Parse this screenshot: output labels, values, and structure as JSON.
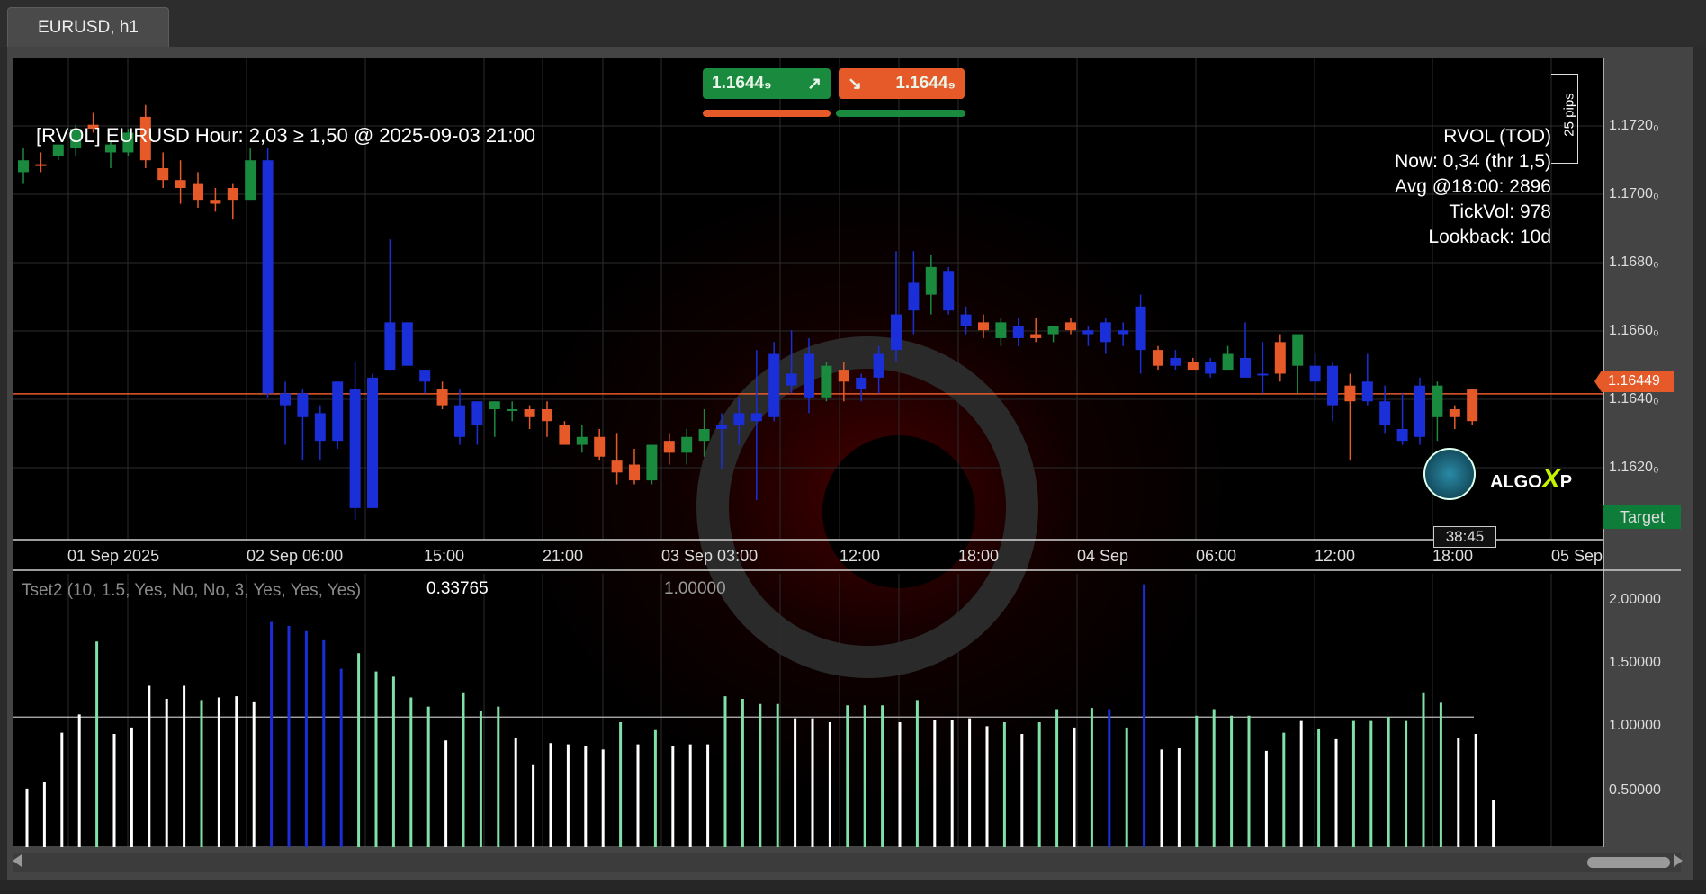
{
  "tab": {
    "label": "EURUSD, h1"
  },
  "quote": {
    "buy_price": "1.1644₉",
    "sell_price": "1.1644₉"
  },
  "rvol_header": "[RVOL] EURUSD Hour: 2,03 ≥ 1,50 @ 2025-09-03 21:00",
  "rvol_box": {
    "title": "RVOL (TOD)",
    "now": "Now: 0,34 (thr 1,5)",
    "avg": "Avg @18:00: 2896",
    "tickvol": "TickVol: 978",
    "lookback": "Lookback: 10d"
  },
  "pips_label": "25 pips",
  "price_axis": [
    "1.1720₀",
    "1.1700₀",
    "1.1680₀",
    "1.1660₀",
    "1.1640₀",
    "1.1620₀"
  ],
  "current_price": "1.16449",
  "time_axis": [
    "01 Sep 2025",
    "02 Sep 06:00",
    "15:00",
    "21:00",
    "03 Sep 03:00",
    "12:00",
    "18:00",
    "04 Sep",
    "06:00",
    "12:00",
    "18:00",
    "05 Sep"
  ],
  "target_label": "Target",
  "timer": "38:45",
  "brand": {
    "text": "ALGO",
    "x": "X",
    "p": "P"
  },
  "indicator": {
    "label": "Tset2 (10, 1.5, Yes, No, No, 3, Yes, Yes, Yes)",
    "value": "0.33765",
    "level": "1.00000",
    "axis": [
      "2.00000",
      "1.50000",
      "1.00000",
      "0.50000"
    ]
  },
  "colors": {
    "bull": "#1a8a3f",
    "bear": "#e65a2a",
    "highvol": "#1a2fd8",
    "mint": "#7fe0a8",
    "white": "#ffffff"
  },
  "chart_data": {
    "type": "candlestick",
    "candles": [
      {
        "o": 1.1704,
        "h": 1.1707,
        "l": 1.1698,
        "c": 1.1701
      },
      {
        "o": 1.1703,
        "h": 1.1706,
        "l": 1.1701,
        "c": 1.1703
      },
      {
        "o": 1.1705,
        "h": 1.1708,
        "l": 1.1704,
        "c": 1.1708
      },
      {
        "o": 1.1707,
        "h": 1.1713,
        "l": 1.1705,
        "c": 1.1712
      },
      {
        "o": 1.1713,
        "h": 1.1716,
        "l": 1.1711,
        "c": 1.1712
      },
      {
        "o": 1.1706,
        "h": 1.1709,
        "l": 1.1702,
        "c": 1.1708
      },
      {
        "o": 1.1706,
        "h": 1.1712,
        "l": 1.1705,
        "c": 1.1711
      },
      {
        "o": 1.1715,
        "h": 1.1718,
        "l": 1.1702,
        "c": 1.1704
      },
      {
        "o": 1.1702,
        "h": 1.1706,
        "l": 1.1697,
        "c": 1.1699
      },
      {
        "o": 1.1699,
        "h": 1.1704,
        "l": 1.1693,
        "c": 1.1697
      },
      {
        "o": 1.1698,
        "h": 1.1701,
        "l": 1.1692,
        "c": 1.1694
      },
      {
        "o": 1.1694,
        "h": 1.1697,
        "l": 1.1691,
        "c": 1.1693
      },
      {
        "o": 1.1697,
        "h": 1.1698,
        "l": 1.1689,
        "c": 1.1694
      },
      {
        "o": 1.1694,
        "h": 1.1707,
        "l": 1.1694,
        "c": 1.1704
      },
      {
        "o": 1.1704,
        "h": 1.1707,
        "l": 1.1644,
        "c": 1.1645
      },
      {
        "o": 1.1645,
        "h": 1.1648,
        "l": 1.1632,
        "c": 1.1642
      },
      {
        "o": 1.1645,
        "h": 1.1646,
        "l": 1.1628,
        "c": 1.1639
      },
      {
        "o": 1.164,
        "h": 1.1642,
        "l": 1.1628,
        "c": 1.1633
      },
      {
        "o": 1.1633,
        "h": 1.1648,
        "l": 1.1631,
        "c": 1.1648
      },
      {
        "o": 1.1646,
        "h": 1.1653,
        "l": 1.1613,
        "c": 1.1616
      },
      {
        "o": 1.1616,
        "h": 1.165,
        "l": 1.1616,
        "c": 1.1649
      },
      {
        "o": 1.1651,
        "h": 1.1684,
        "l": 1.1651,
        "c": 1.1663
      },
      {
        "o": 1.1663,
        "h": 1.1663,
        "l": 1.1652,
        "c": 1.1652
      },
      {
        "o": 1.1651,
        "h": 1.1651,
        "l": 1.1645,
        "c": 1.1648
      },
      {
        "o": 1.1646,
        "h": 1.1648,
        "l": 1.1641,
        "c": 1.1642
      },
      {
        "o": 1.1642,
        "h": 1.1646,
        "l": 1.1632,
        "c": 1.1634
      },
      {
        "o": 1.1637,
        "h": 1.1643,
        "l": 1.1632,
        "c": 1.1643
      },
      {
        "o": 1.1643,
        "h": 1.1643,
        "l": 1.1634,
        "c": 1.1641
      },
      {
        "o": 1.1641,
        "h": 1.1643,
        "l": 1.1638,
        "c": 1.1641
      },
      {
        "o": 1.1641,
        "h": 1.1642,
        "l": 1.1636,
        "c": 1.1639
      },
      {
        "o": 1.1641,
        "h": 1.1643,
        "l": 1.1634,
        "c": 1.1638
      },
      {
        "o": 1.1637,
        "h": 1.1638,
        "l": 1.1632,
        "c": 1.1632
      },
      {
        "o": 1.1632,
        "h": 1.1637,
        "l": 1.163,
        "c": 1.1634
      },
      {
        "o": 1.1634,
        "h": 1.1636,
        "l": 1.1628,
        "c": 1.1629
      },
      {
        "o": 1.1628,
        "h": 1.1635,
        "l": 1.1622,
        "c": 1.1625
      },
      {
        "o": 1.1627,
        "h": 1.1631,
        "l": 1.1622,
        "c": 1.1623
      },
      {
        "o": 1.1623,
        "h": 1.1632,
        "l": 1.1622,
        "c": 1.1632
      },
      {
        "o": 1.1633,
        "h": 1.1635,
        "l": 1.1627,
        "c": 1.163
      },
      {
        "o": 1.163,
        "h": 1.1636,
        "l": 1.1627,
        "c": 1.1634
      },
      {
        "o": 1.1633,
        "h": 1.1641,
        "l": 1.1629,
        "c": 1.1636
      },
      {
        "o": 1.1636,
        "h": 1.164,
        "l": 1.1626,
        "c": 1.1637
      },
      {
        "o": 1.1637,
        "h": 1.1644,
        "l": 1.1632,
        "c": 1.164
      },
      {
        "o": 1.164,
        "h": 1.1656,
        "l": 1.1618,
        "c": 1.1638
      },
      {
        "o": 1.1639,
        "h": 1.1658,
        "l": 1.1638,
        "c": 1.1655
      },
      {
        "o": 1.1647,
        "h": 1.1661,
        "l": 1.1645,
        "c": 1.165
      },
      {
        "o": 1.1655,
        "h": 1.1659,
        "l": 1.164,
        "c": 1.1644
      },
      {
        "o": 1.1644,
        "h": 1.1653,
        "l": 1.1643,
        "c": 1.1652
      },
      {
        "o": 1.1651,
        "h": 1.1653,
        "l": 1.1643,
        "c": 1.1648
      },
      {
        "o": 1.1646,
        "h": 1.165,
        "l": 1.1643,
        "c": 1.1649
      },
      {
        "o": 1.1649,
        "h": 1.1657,
        "l": 1.1645,
        "c": 1.1655
      },
      {
        "o": 1.1656,
        "h": 1.1681,
        "l": 1.1653,
        "c": 1.1665
      },
      {
        "o": 1.1666,
        "h": 1.1681,
        "l": 1.166,
        "c": 1.1673
      },
      {
        "o": 1.167,
        "h": 1.168,
        "l": 1.1665,
        "c": 1.1677
      },
      {
        "o": 1.1676,
        "h": 1.1677,
        "l": 1.1665,
        "c": 1.1666
      },
      {
        "o": 1.1665,
        "h": 1.1667,
        "l": 1.166,
        "c": 1.1662
      },
      {
        "o": 1.1663,
        "h": 1.1665,
        "l": 1.1659,
        "c": 1.1661
      },
      {
        "o": 1.1663,
        "h": 1.1664,
        "l": 1.1657,
        "c": 1.1659
      },
      {
        "o": 1.1659,
        "h": 1.1664,
        "l": 1.1657,
        "c": 1.1662
      },
      {
        "o": 1.1659,
        "h": 1.1664,
        "l": 1.1658,
        "c": 1.166
      },
      {
        "o": 1.166,
        "h": 1.1662,
        "l": 1.1658,
        "c": 1.1662
      },
      {
        "o": 1.1663,
        "h": 1.1664,
        "l": 1.166,
        "c": 1.1661
      },
      {
        "o": 1.166,
        "h": 1.1662,
        "l": 1.1657,
        "c": 1.1661
      },
      {
        "o": 1.1663,
        "h": 1.1664,
        "l": 1.1655,
        "c": 1.1658
      },
      {
        "o": 1.166,
        "h": 1.1663,
        "l": 1.1657,
        "c": 1.1661
      },
      {
        "o": 1.1667,
        "h": 1.167,
        "l": 1.165,
        "c": 1.1656
      },
      {
        "o": 1.1656,
        "h": 1.1657,
        "l": 1.1651,
        "c": 1.1652
      },
      {
        "o": 1.1652,
        "h": 1.1656,
        "l": 1.1651,
        "c": 1.1654
      },
      {
        "o": 1.1653,
        "h": 1.1654,
        "l": 1.1651,
        "c": 1.1651
      },
      {
        "o": 1.1653,
        "h": 1.1654,
        "l": 1.1649,
        "c": 1.165
      },
      {
        "o": 1.1655,
        "h": 1.1657,
        "l": 1.1651,
        "c": 1.1651
      },
      {
        "o": 1.1654,
        "h": 1.1663,
        "l": 1.165,
        "c": 1.1649
      },
      {
        "o": 1.165,
        "h": 1.1658,
        "l": 1.1645,
        "c": 1.165
      },
      {
        "o": 1.165,
        "h": 1.166,
        "l": 1.1648,
        "c": 1.1658
      },
      {
        "o": 1.166,
        "h": 1.166,
        "l": 1.1645,
        "c": 1.1652
      },
      {
        "o": 1.1652,
        "h": 1.1655,
        "l": 1.1644,
        "c": 1.1648
      },
      {
        "o": 1.1652,
        "h": 1.1653,
        "l": 1.1638,
        "c": 1.1642
      },
      {
        "o": 1.1647,
        "h": 1.165,
        "l": 1.1628,
        "c": 1.1643
      },
      {
        "o": 1.1648,
        "h": 1.1655,
        "l": 1.1642,
        "c": 1.1643
      },
      {
        "o": 1.1643,
        "h": 1.1647,
        "l": 1.1635,
        "c": 1.1637
      },
      {
        "o": 1.1636,
        "h": 1.1645,
        "l": 1.1632,
        "c": 1.1633
      },
      {
        "o": 1.1634,
        "h": 1.1649,
        "l": 1.1632,
        "c": 1.1647
      },
      {
        "o": 1.1647,
        "h": 1.1648,
        "l": 1.1633,
        "c": 1.1639
      },
      {
        "o": 1.1641,
        "h": 1.1642,
        "l": 1.1636,
        "c": 1.1639
      },
      {
        "o": 1.1638,
        "h": 1.1646,
        "l": 1.1637,
        "c": 1.1646
      }
    ],
    "candle_class": [
      "bull",
      "bear",
      "bull",
      "bull",
      "bear",
      "bull",
      "bull",
      "bear",
      "bear",
      "bear",
      "bear",
      "bear",
      "bear",
      "bull",
      "hv",
      "hv",
      "hv",
      "hv",
      "hv",
      "hv",
      "hv",
      "hv",
      "hv",
      "hv",
      "bear",
      "hv",
      "hv",
      "bull",
      "bull",
      "bear",
      "bear",
      "bear",
      "bull",
      "bear",
      "bear",
      "bear",
      "bull",
      "bear",
      "bull",
      "bull",
      "hv",
      "hv",
      "hv",
      "hv",
      "hv",
      "hv",
      "bull",
      "bear",
      "hv",
      "hv",
      "hv",
      "hv",
      "bull",
      "hv",
      "hv",
      "bear",
      "bull",
      "hv",
      "bear",
      "bull",
      "bear",
      "hv",
      "hv",
      "hv",
      "hv",
      "bear",
      "hv",
      "bear",
      "hv",
      "bull",
      "hv",
      "hv",
      "bear",
      "bull",
      "hv",
      "hv",
      "bear",
      "hv",
      "hv",
      "hv",
      "hv",
      "bull",
      "bear",
      "bear",
      "bull"
    ],
    "y_range": [
      1.1608,
      1.173
    ],
    "indicator_values": [
      0.45,
      0.5,
      0.88,
      1.02,
      1.58,
      0.87,
      0.92,
      1.24,
      1.14,
      1.24,
      1.13,
      1.15,
      1.16,
      1.12,
      1.73,
      1.7,
      1.66,
      1.59,
      1.37,
      1.49,
      1.35,
      1.31,
      1.15,
      1.08,
      0.82,
      1.19,
      1.05,
      1.08,
      0.84,
      0.63,
      0.8,
      0.79,
      0.78,
      0.75,
      0.96,
      0.79,
      0.9,
      0.78,
      0.79,
      0.79,
      1.16,
      1.14,
      1.1,
      1.1,
      0.99,
      0.99,
      0.96,
      1.09,
      1.09,
      1.09,
      0.96,
      1.13,
      0.98,
      0.98,
      0.99,
      0.93,
      0.96,
      0.87,
      0.96,
      1.06,
      0.92,
      1.07,
      1.06,
      0.92,
      2.02,
      0.75,
      0.76,
      1.01,
      1.06,
      1.01,
      1.01,
      0.74,
      0.88,
      0.97,
      0.91,
      0.83,
      0.97,
      0.97,
      1.0,
      0.97,
      1.19,
      1.11,
      0.84,
      0.87,
      0.36
    ],
    "indicator_class": [
      "w",
      "w",
      "w",
      "w",
      "m",
      "w",
      "w",
      "w",
      "w",
      "w",
      "m",
      "w",
      "w",
      "w",
      "hv",
      "hv",
      "hv",
      "hv",
      "hv",
      "m",
      "m",
      "m",
      "m",
      "m",
      "w",
      "m",
      "m",
      "m",
      "w",
      "w",
      "w",
      "w",
      "w",
      "w",
      "m",
      "w",
      "m",
      "w",
      "w",
      "w",
      "m",
      "m",
      "m",
      "m",
      "w",
      "w",
      "w",
      "m",
      "m",
      "m",
      "w",
      "m",
      "w",
      "w",
      "w",
      "w",
      "m",
      "w",
      "m",
      "m",
      "w",
      "m",
      "hv",
      "m",
      "hv",
      "w",
      "w",
      "m",
      "m",
      "m",
      "m",
      "w",
      "m",
      "w",
      "m",
      "w",
      "m",
      "m",
      "m",
      "m",
      "m",
      "m",
      "w",
      "w",
      "w"
    ],
    "indicator_range": [
      0,
      2.1
    ]
  }
}
